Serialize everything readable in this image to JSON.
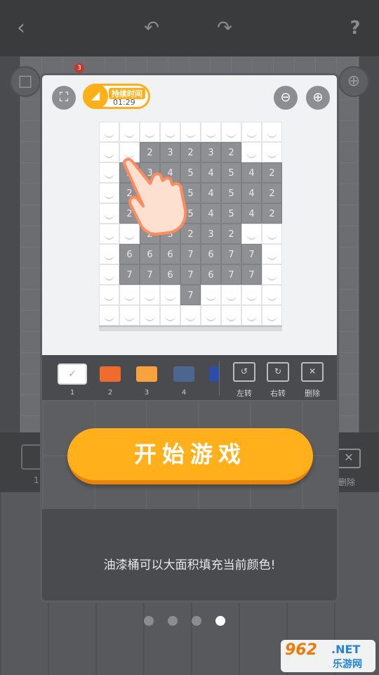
{
  "background": {
    "toolbar_left_label": "1",
    "toolbar_right_label": "删除",
    "badge": "3"
  },
  "modal": {
    "timer_label": "持续时间",
    "timer_value": "01:29",
    "grid": [
      [
        "W",
        "W",
        "W",
        "W",
        "W",
        "W",
        "W",
        "W",
        "W"
      ],
      [
        "W",
        "W",
        "2",
        "3",
        "2",
        "3",
        "2",
        "W",
        "W"
      ],
      [
        "W",
        "2",
        "3",
        "4",
        "5",
        "4",
        "5",
        "4",
        "2"
      ],
      [
        "W",
        "2",
        "5",
        "4",
        "5",
        "4",
        "5",
        "4",
        "2"
      ],
      [
        "W",
        "2",
        "3",
        "4",
        "5",
        "4",
        "5",
        "4",
        "2"
      ],
      [
        "W",
        "W",
        "2",
        "3",
        "2",
        "3",
        "2",
        "W",
        "W"
      ],
      [
        "W",
        "6",
        "6",
        "6",
        "7",
        "6",
        "7",
        "7",
        "W"
      ],
      [
        "W",
        "7",
        "7",
        "6",
        "7",
        "6",
        "7",
        "7",
        "W"
      ],
      [
        "W",
        "W",
        "W",
        "W",
        "7",
        "W",
        "W",
        "W",
        "W"
      ],
      [
        "W",
        "W",
        "W",
        "W",
        "W",
        "W",
        "W",
        "W",
        "W"
      ]
    ],
    "palette": [
      {
        "label": "1",
        "color": "#ffffff"
      },
      {
        "label": "2",
        "color": "#f26b2e"
      },
      {
        "label": "3",
        "color": "#f9a23b"
      },
      {
        "label": "4",
        "color": "#4d6690"
      },
      {
        "label": "",
        "color": "#2d4ea6"
      }
    ],
    "tools": {
      "rotate_left": "左转",
      "rotate_right": "右转",
      "delete": "删除"
    },
    "start_button": "开始游戏",
    "hint": "油漆桶可以大面积填充当前颜色!"
  },
  "pager": {
    "count": 4,
    "active": 3
  },
  "watermark": {
    "number": "962",
    "net": ".NET",
    "site": "乐游网"
  }
}
